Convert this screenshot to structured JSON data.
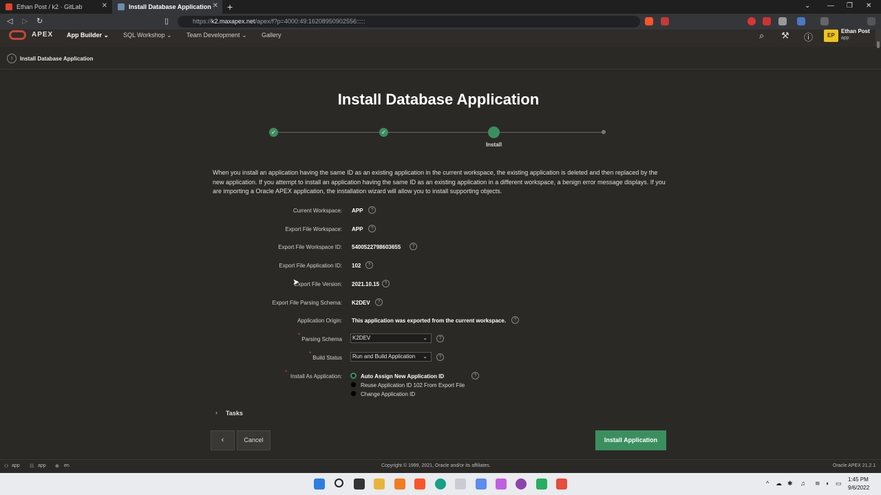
{
  "browser": {
    "tabs": [
      {
        "title": "Ethan Post / k2 · GitLab",
        "active": false
      },
      {
        "title": "Install Database Application",
        "active": true
      }
    ],
    "url_host": "k2.maxapex.net",
    "url_prefix": "https://",
    "url_path": "/apex/f?p=4000:49:16208950902556:::::"
  },
  "header": {
    "logo": "APEX",
    "menus": [
      "App Builder",
      "SQL Workshop",
      "Team Development",
      "Gallery"
    ],
    "user_initials": "EP",
    "user_name": "Ethan Post",
    "workspace": "app"
  },
  "breadcrumb": {
    "label": "Install Database Application"
  },
  "main": {
    "title": "Install Database Application",
    "current_step_label": "Install",
    "intro": "When you install an application having the same ID as an existing application in the current workspace, the existing application is deleted and then replaced by the new application. If you attempt to install an application having the same ID as an existing application in a different workspace, a benign error message displays. If you are importing a Oracle APEX application, the installation wizard will allow you to install supporting objects.",
    "fields": [
      {
        "label": "Current Workspace:",
        "value": "APP"
      },
      {
        "label": "Export File Workspace:",
        "value": "APP"
      },
      {
        "label": "Export File Workspace ID:",
        "value": "5400522798603655"
      },
      {
        "label": "Export File Application ID:",
        "value": "102"
      },
      {
        "label": "Export File Version:",
        "value": "2021.10.15"
      },
      {
        "label": "Export File Parsing Schema:",
        "value": "K2DEV"
      },
      {
        "label": "Application Origin:",
        "value": "This application was exported from the current workspace."
      }
    ],
    "parsing_schema": {
      "label": "Parsing Schema",
      "value": "K2DEV"
    },
    "build_status": {
      "label": "Build Status",
      "value": "Run and Build Application"
    },
    "install_as": {
      "label": "Install As Application:",
      "options": [
        "Auto Assign New Application ID",
        "Reuse Application ID 102 From Export File",
        "Change Application ID"
      ],
      "selected": "Auto Assign New Application ID"
    },
    "tasks_label": "Tasks",
    "cancel_label": "Cancel",
    "install_label": "Install Application"
  },
  "footer": {
    "user": "app",
    "workspace": "app",
    "language": "en",
    "copyright": "Copyright © 1999, 2021, Oracle and/or its affiliates.",
    "version": "Oracle APEX 21.2.1"
  },
  "taskbar": {
    "time": "1:45 PM",
    "date": "9/6/2022"
  },
  "colors": {
    "accent": "#3b8f5f",
    "background": "#2b2926",
    "required": "#e0473b",
    "avatar": "#f0c419"
  }
}
